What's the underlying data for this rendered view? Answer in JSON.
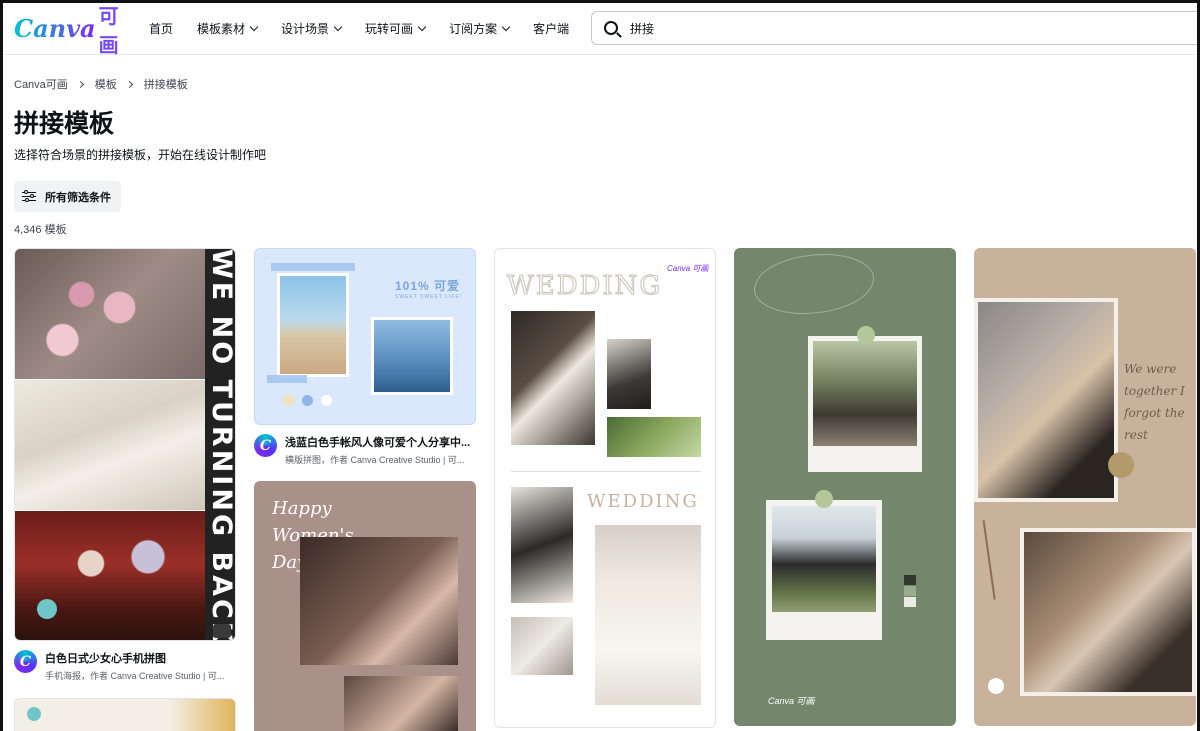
{
  "header": {
    "logo_text": "Canva",
    "logo_cn": "可画",
    "nav": [
      {
        "label": "首页",
        "dropdown": false
      },
      {
        "label": "模板素材",
        "dropdown": true
      },
      {
        "label": "设计场景",
        "dropdown": true
      },
      {
        "label": "玩转可画",
        "dropdown": true
      },
      {
        "label": "订阅方案",
        "dropdown": true
      },
      {
        "label": "客户端",
        "dropdown": false
      }
    ],
    "search_value": "拼接"
  },
  "breadcrumb": [
    "Canva可画",
    "模板",
    "拼接模板"
  ],
  "page": {
    "title": "拼接模板",
    "subtitle": "选择符合场景的拼接模板，开始在线设计制作吧",
    "filter_label": "所有筛选条件",
    "count": "4,346 模板"
  },
  "cards": [
    {
      "title": "白色日式少女心手机拼图",
      "sub": "手机海报，作者 Canva Creative Studio | 可...",
      "vertical_text": "WE NO TURNING BACK"
    },
    {
      "title": "浅蓝白色手帐风人像可爱个人分享中...",
      "sub": "横版拼图，作者 Canva Creative Studio | 可...",
      "badge": "101% 可爱",
      "badge_sub": "SWEET SWEET LIFE!"
    },
    {
      "title_text": "WEDDING",
      "title_text2": "WEDDING"
    },
    {
      "brand": "Canva 可画"
    },
    {
      "script": "We were together I forgot the rest"
    },
    {
      "happy": "Happy Women's Day"
    }
  ],
  "colors": {
    "accent": "#7d2ae8",
    "teal": "#00c4cc",
    "sage": "#74876d",
    "taupe": "#c9b29b"
  }
}
